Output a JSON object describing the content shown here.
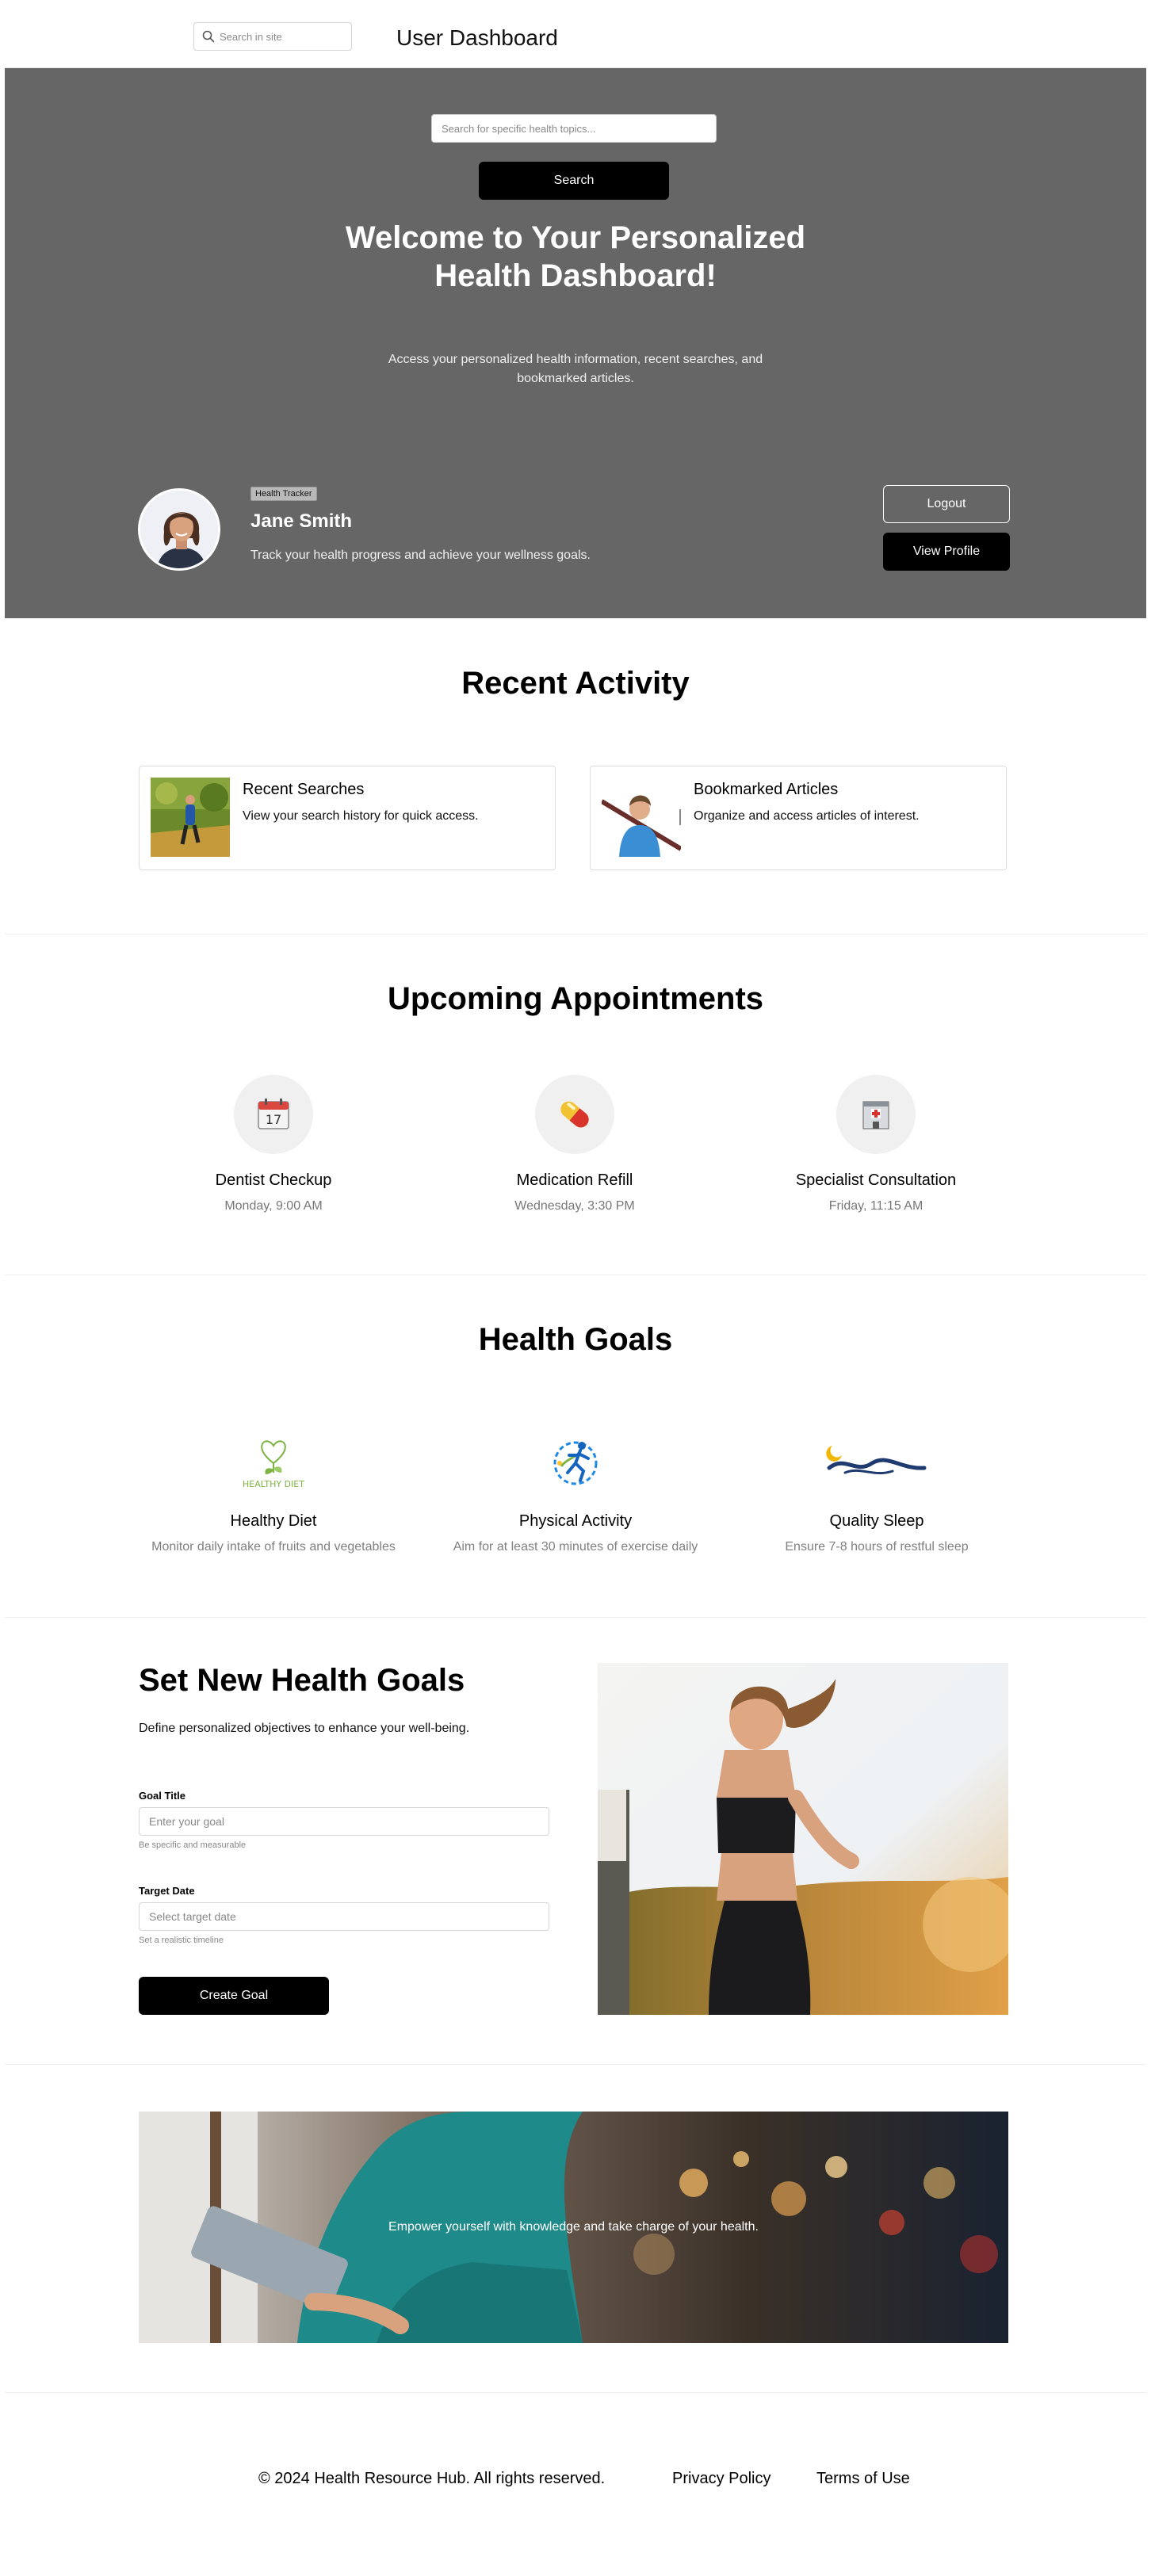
{
  "header": {
    "site_search_placeholder": "Search in site",
    "title": "User Dashboard"
  },
  "hero": {
    "search_placeholder": "Search for specific health topics...",
    "search_button": "Search",
    "title": "Welcome to Your Personalized Health Dashboard!",
    "subtitle": "Access your personalized health information, recent searches, and bookmarked articles.",
    "profile": {
      "badge": "Health Tracker",
      "name": "Jane Smith",
      "description": "Track your health progress and achieve your wellness goals.",
      "logout_label": "Logout",
      "view_profile_label": "View Profile"
    }
  },
  "activity": {
    "title": "Recent Activity",
    "cards": [
      {
        "title": "Recent Searches",
        "description": "View your search history for quick access."
      },
      {
        "title": "Bookmarked Articles",
        "description": "Organize and access articles of interest."
      }
    ]
  },
  "appointments": {
    "title": "Upcoming Appointments",
    "items": [
      {
        "title": "Dentist Checkup",
        "time": "Monday, 9:00 AM",
        "icon": "calendar-icon"
      },
      {
        "title": "Medication Refill",
        "time": "Wednesday, 3:30 PM",
        "icon": "pill-icon"
      },
      {
        "title": "Specialist Consultation",
        "time": "Friday, 11:15 AM",
        "icon": "hospital-icon"
      }
    ]
  },
  "goals": {
    "title": "Health Goals",
    "items": [
      {
        "title": "Healthy Diet",
        "description": "Monitor daily intake of fruits and vegetables",
        "logo_text": "HEALTHY DIET"
      },
      {
        "title": "Physical Activity",
        "description": "Aim for at least 30 minutes of exercise daily"
      },
      {
        "title": "Quality Sleep",
        "description": "Ensure 7-8 hours of restful sleep"
      }
    ]
  },
  "goal_form": {
    "title": "Set New Health Goals",
    "subtitle": "Define personalized objectives to enhance your well-being.",
    "goal_title_label": "Goal Title",
    "goal_title_placeholder": "Enter your goal",
    "goal_title_hint": "Be specific and measurable",
    "target_date_label": "Target Date",
    "target_date_placeholder": "Select target date",
    "target_date_hint": "Set a realistic timeline",
    "submit_label": "Create Goal"
  },
  "banner": {
    "text": "Empower yourself with knowledge and take charge of your health."
  },
  "footer": {
    "copyright": "© 2024 Health Resource Hub. All rights reserved.",
    "privacy": "Privacy Policy",
    "terms": "Terms of Use"
  },
  "colors": {
    "hero_bg": "#666666",
    "primary_button": "#000000",
    "muted_text": "#777777"
  }
}
